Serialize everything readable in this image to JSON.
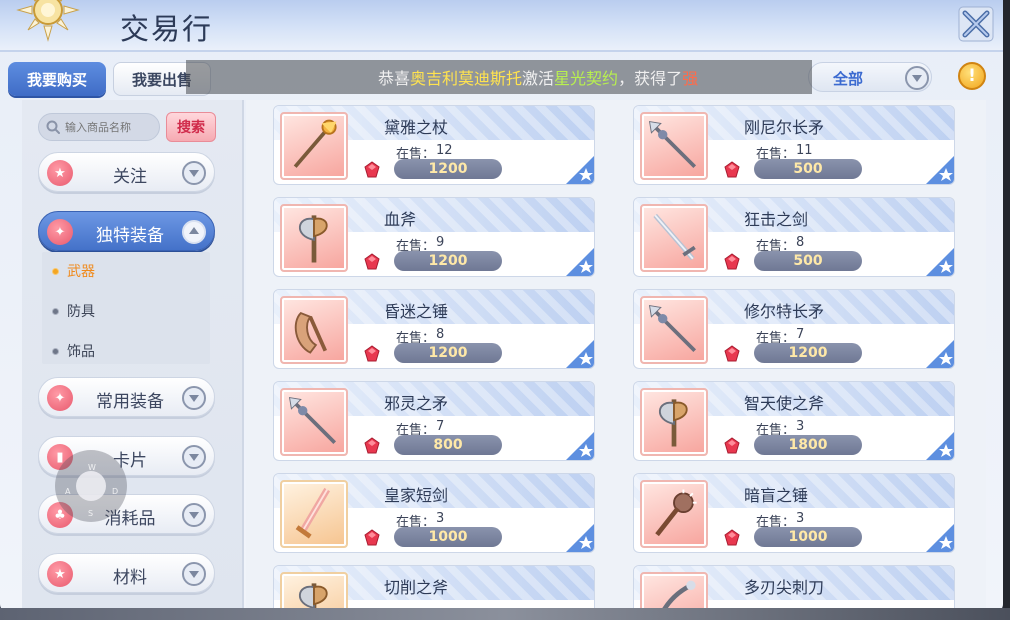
{
  "window": {
    "title": "交易行"
  },
  "tabs": [
    {
      "label": "我要购买",
      "active": true
    },
    {
      "label": "我要出售",
      "active": false
    }
  ],
  "broadcast": {
    "prefix": "恭喜",
    "player": "奥吉利莫迪斯托",
    "verb": "激活",
    "item": "星光契约",
    "middle": "，获得了",
    "tail": "强"
  },
  "filter": {
    "selected": "全部"
  },
  "search": {
    "placeholder": "输入商品名称",
    "button_label": "搜索"
  },
  "categories": [
    {
      "label": "关注",
      "icon": "star-icon",
      "expanded": false
    },
    {
      "label": "独特装备",
      "icon": "crest-icon",
      "expanded": true
    },
    {
      "label": "常用装备",
      "icon": "crest-icon",
      "expanded": false
    },
    {
      "label": "卡片",
      "icon": "card-icon",
      "expanded": false
    },
    {
      "label": "消耗品",
      "icon": "potion-icon",
      "expanded": false
    },
    {
      "label": "材料",
      "icon": "star-icon",
      "expanded": false
    }
  ],
  "subcategories": [
    {
      "label": "武器",
      "active": true
    },
    {
      "label": "防具",
      "active": false
    },
    {
      "label": "饰品",
      "active": false
    }
  ],
  "joystick": {
    "labels": [
      "W",
      "A",
      "D",
      "S"
    ]
  },
  "stock_label": "在售：",
  "items": [
    {
      "name": "黛雅之杖",
      "stock": "12",
      "price": "1200",
      "icon": "staff-icon",
      "thumb": "red"
    },
    {
      "name": "刚尼尔长矛",
      "stock": "11",
      "price": "500",
      "icon": "spear-icon",
      "thumb": "red"
    },
    {
      "name": "血斧",
      "stock": "9",
      "price": "1200",
      "icon": "axe-icon",
      "thumb": "red"
    },
    {
      "name": "狂击之剑",
      "stock": "8",
      "price": "500",
      "icon": "sword-icon",
      "thumb": "red"
    },
    {
      "name": "昏迷之锤",
      "stock": "8",
      "price": "1200",
      "icon": "hammer-icon",
      "thumb": "red"
    },
    {
      "name": "修尔特长矛",
      "stock": "7",
      "price": "1200",
      "icon": "spear-icon",
      "thumb": "red"
    },
    {
      "name": "邪灵之矛",
      "stock": "7",
      "price": "800",
      "icon": "spear-icon",
      "thumb": "red"
    },
    {
      "name": "智天使之斧",
      "stock": "3",
      "price": "1800",
      "icon": "axe-icon",
      "thumb": "red"
    },
    {
      "name": "皇家短剑",
      "stock": "3",
      "price": "1000",
      "icon": "dagger-icon",
      "thumb": "gold"
    },
    {
      "name": "暗盲之锤",
      "stock": "3",
      "price": "1000",
      "icon": "mace-icon",
      "thumb": "red"
    },
    {
      "name": "切削之斧",
      "stock": "",
      "price": "",
      "icon": "axe-icon",
      "thumb": "gold"
    },
    {
      "name": "多刃尖刺刀",
      "stock": "",
      "price": "",
      "icon": "blade-icon",
      "thumb": "red"
    }
  ],
  "colors": {
    "accent": "#4472c9",
    "price_text": "#ffe9a8",
    "active_sub": "#f08a1c",
    "gem": "#e8384f"
  }
}
